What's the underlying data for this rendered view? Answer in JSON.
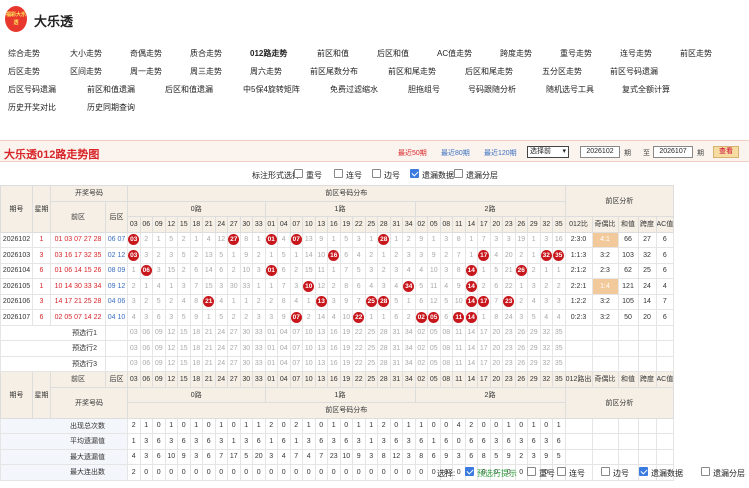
{
  "header": {
    "logo_text": "福彩大乐透",
    "site_name": "大乐透"
  },
  "nav": {
    "rows": [
      [
        "综合走势",
        "大小走势",
        "奇偶走势",
        "质合走势",
        "012路走势",
        "前区和值",
        "后区和值",
        "AC值走势",
        "跨度走势",
        "重号走势",
        "连号走势",
        "前区走势"
      ],
      [
        "后区走势",
        "区间走势",
        "周一走势",
        "周三走势",
        "周六走势",
        "前区尾数分布",
        "前区和尾走势",
        "后区和尾走势",
        "五分区走势",
        "前区号码遗漏"
      ],
      [
        "后区号码遗漏",
        "前区和值遗漏",
        "后区和值遗漏",
        "中5保4旋转矩阵",
        "免费过滤缩水",
        "胆拖组号",
        "号码跟随分析",
        "随机选号工具",
        "复式全额计算"
      ],
      [
        "历史开奖对比",
        "历史同期查询"
      ]
    ],
    "bold_item": "012路走势"
  },
  "panel": {
    "title": "大乐透012路走势图",
    "links": {
      "last50": "最近50期",
      "last80": "最近80期",
      "last120": "最近120期"
    },
    "select": "选择前",
    "from": "2026102",
    "from_unit": "期",
    "to_label": "至",
    "to": "2026107",
    "to_unit": "期",
    "query": "查看"
  },
  "mark": {
    "label": "标注形式选择:",
    "options": [
      {
        "label": "重号",
        "on": false
      },
      {
        "label": "连号",
        "on": false
      },
      {
        "label": "边号",
        "on": false
      },
      {
        "label": "遗漏数据",
        "on": true
      },
      {
        "label": "遗漏分层",
        "on": false
      }
    ]
  },
  "table": {
    "h_issue": "期号",
    "h_week": "星期",
    "h_draw": "开奖号码",
    "h_front": "前区",
    "h_back": "后区",
    "h_dist": "前区号码分布",
    "h_road0": "0路",
    "h_road1": "1路",
    "h_road2": "2路",
    "h_analysis": "前区分析",
    "analysis_cols": [
      "012比",
      "奇偶比",
      "和值",
      "跨度",
      "AC值"
    ],
    "road0_nums": [
      "03",
      "06",
      "09",
      "12",
      "15",
      "18",
      "21",
      "24",
      "27",
      "30",
      "33"
    ],
    "road1_nums": [
      "01",
      "04",
      "07",
      "10",
      "13",
      "16",
      "19",
      "22",
      "25",
      "28",
      "31",
      "34"
    ],
    "road2_nums": [
      "02",
      "05",
      "08",
      "11",
      "14",
      "17",
      "20",
      "23",
      "26",
      "29",
      "32",
      "35"
    ],
    "rows": [
      {
        "issue": "2026102",
        "week": "1",
        "front": "01 03 07 27 28",
        "back": "06 07",
        "cells0": [
          "03",
          "2",
          "1",
          "5",
          "2",
          "1",
          "4",
          "12",
          "27",
          "8",
          "1"
        ],
        "cells1": [
          "01",
          "4",
          "07",
          "13",
          "9",
          "1",
          "5",
          "3",
          "1",
          "28",
          "1",
          "2"
        ],
        "cells2": [
          "9",
          "1",
          "3",
          "8",
          "1",
          "7",
          "3",
          "3",
          "19",
          "1",
          "3",
          "16"
        ],
        "stats": [
          "2:3:0",
          "4:1",
          "66",
          "27",
          "6"
        ]
      },
      {
        "issue": "2026103",
        "week": "3",
        "front": "03 16 17 32 35",
        "back": "02 12",
        "cells0": [
          "03",
          "3",
          "2",
          "3",
          "5",
          "2",
          "13",
          "5",
          "1",
          "9",
          "2"
        ],
        "cells1": [
          "1",
          "5",
          "1",
          "14",
          "10",
          "16",
          "6",
          "4",
          "2",
          "1",
          "2",
          "3"
        ],
        "cells2": [
          "3",
          "9",
          "2",
          "7",
          "1",
          "17",
          "4",
          "20",
          "2",
          "1",
          "32",
          "35"
        ],
        "stats": [
          "1:1:3",
          "3:2",
          "103",
          "32",
          "6"
        ]
      },
      {
        "issue": "2026104",
        "week": "6",
        "front": "01 06 14 15 26",
        "back": "08 09",
        "cells0": [
          "1",
          "06",
          "3",
          "15",
          "2",
          "6",
          "14",
          "6",
          "2",
          "10",
          "3"
        ],
        "cells1": [
          "01",
          "6",
          "2",
          "15",
          "11",
          "1",
          "7",
          "5",
          "3",
          "2",
          "3",
          "4"
        ],
        "cells2": [
          "4",
          "10",
          "3",
          "8",
          "14",
          "1",
          "5",
          "21",
          "26",
          "2",
          "1",
          "1"
        ],
        "stats": [
          "2:1:2",
          "2:3",
          "62",
          "25",
          "6"
        ]
      },
      {
        "issue": "2026105",
        "week": "1",
        "front": "10 14 30 33 34",
        "back": "09 12",
        "cells0": [
          "2",
          "1",
          "4",
          "1",
          "3",
          "7",
          "15",
          "3",
          "30",
          "33",
          "1"
        ],
        "cells1": [
          "1",
          "7",
          "3",
          "10",
          "12",
          "2",
          "8",
          "6",
          "4",
          "3",
          "4",
          "34"
        ],
        "cells2": [
          "5",
          "11",
          "4",
          "9",
          "14",
          "2",
          "6",
          "22",
          "1",
          "3",
          "2",
          "2"
        ],
        "stats": [
          "2:2:1",
          "1:4",
          "121",
          "24",
          "4"
        ]
      },
      {
        "issue": "2026106",
        "week": "3",
        "front": "14 17 21 25 28",
        "back": "04 06",
        "cells0": [
          "3",
          "2",
          "5",
          "2",
          "4",
          "8",
          "21",
          "4",
          "1",
          "1",
          "2"
        ],
        "cells1": [
          "2",
          "8",
          "4",
          "1",
          "13",
          "3",
          "9",
          "7",
          "25",
          "28",
          "5",
          "1"
        ],
        "cells2": [
          "6",
          "12",
          "5",
          "10",
          "14",
          "17",
          "7",
          "23",
          "2",
          "4",
          "3",
          "3"
        ],
        "stats": [
          "1:2:2",
          "3:2",
          "105",
          "14",
          "7"
        ]
      },
      {
        "issue": "2026107",
        "week": "6",
        "front": "02 05 07 14 22",
        "back": "04 10",
        "cells0": [
          "4",
          "3",
          "6",
          "3",
          "5",
          "9",
          "1",
          "5",
          "2",
          "2",
          "3"
        ],
        "cells1": [
          "3",
          "9",
          "07",
          "2",
          "14",
          "4",
          "10",
          "22",
          "1",
          "1",
          "6",
          "2"
        ],
        "cells2": [
          "02",
          "05",
          "6",
          "11",
          "14",
          "1",
          "8",
          "24",
          "3",
          "5",
          "4",
          "4"
        ],
        "stats": [
          "0:2:3",
          "3:2",
          "50",
          "20",
          "6"
        ]
      }
    ],
    "predict": [
      "预选行1",
      "预选行2",
      "预选行3"
    ],
    "stat_rows": [
      {
        "label": "出现总次数",
        "vals": [
          "2",
          "1",
          "0",
          "1",
          "0",
          "1",
          "0",
          "1",
          "0",
          "1",
          "1",
          "2",
          "0",
          "2",
          "1",
          "0",
          "1",
          "0",
          "1",
          "1",
          "2",
          "0",
          "1",
          "1",
          "0",
          "0",
          "4",
          "2",
          "0",
          "0",
          "1",
          "0",
          "1",
          "0",
          "1"
        ]
      },
      {
        "label": "平均遗漏值",
        "vals": [
          "1",
          "3",
          "6",
          "3",
          "6",
          "3",
          "6",
          "3",
          "1",
          "3",
          "6",
          "1",
          "6",
          "1",
          "3",
          "6",
          "3",
          "6",
          "3",
          "1",
          "3",
          "6",
          "3",
          "6",
          "1",
          "6",
          "0",
          "6",
          "6",
          "3",
          "6",
          "3",
          "6",
          "3",
          "6"
        ]
      },
      {
        "label": "最大遗漏值",
        "vals": [
          "4",
          "3",
          "6",
          "10",
          "9",
          "3",
          "6",
          "7",
          "17",
          "5",
          "20",
          "3",
          "4",
          "7",
          "4",
          "7",
          "23",
          "10",
          "9",
          "3",
          "8",
          "12",
          "3",
          "8",
          "6",
          "9",
          "3",
          "6",
          "8",
          "5",
          "9",
          "2",
          "3",
          "9",
          "5"
        ]
      },
      {
        "label": "最大连出数",
        "vals": [
          "2",
          "0",
          "0",
          "0",
          "0",
          "0",
          "0",
          "0",
          "0",
          "0",
          "0",
          "0",
          "0",
          "0",
          "0",
          "0",
          "0",
          "0",
          "0",
          "0",
          "0",
          "0",
          "0",
          "0",
          "0",
          "0",
          "0",
          "0",
          "0",
          "0",
          "0",
          "0",
          "0",
          "0",
          "0"
        ]
      }
    ],
    "bottom_header": {
      "analysis": [
        "012路出",
        "奇偶比",
        "和值",
        "跨度",
        "AC值"
      ]
    }
  },
  "foot": {
    "label": "选择:",
    "options": [
      {
        "label": "预选行提示",
        "on": true
      },
      {
        "label": "重号",
        "on": false
      },
      {
        "label": "连号",
        "on": false
      },
      {
        "label": "边号",
        "on": false
      },
      {
        "label": "遗漏数据",
        "on": true
      },
      {
        "label": "遗漏分层",
        "on": false
      }
    ]
  }
}
